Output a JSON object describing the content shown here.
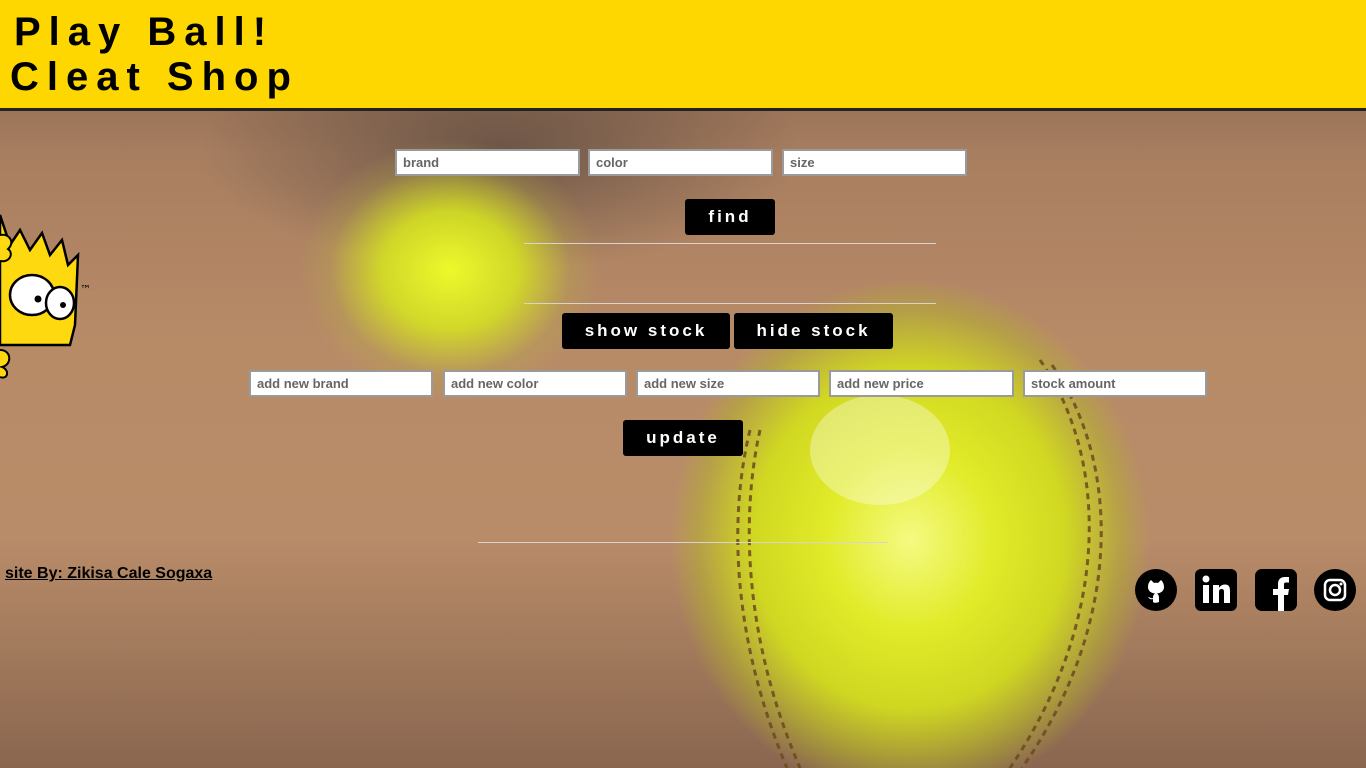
{
  "header": {
    "title_line1": "Play Ball!",
    "title_line2": "Cleat Shop"
  },
  "search": {
    "brand_placeholder": "brand",
    "color_placeholder": "color",
    "size_placeholder": "size",
    "find_label": "find"
  },
  "stock": {
    "show_label": "show stock",
    "hide_label": "hide stock"
  },
  "update_form": {
    "brand_placeholder": "add new brand",
    "color_placeholder": "add new color",
    "size_placeholder": "add new size",
    "price_placeholder": "add new price",
    "stock_placeholder": "stock amount",
    "update_label": "update"
  },
  "mascot": {
    "trademark": "™"
  },
  "footer": {
    "credit": "site By: Zikisa Cale Sogaxa",
    "social": [
      "github-icon",
      "linkedin-icon",
      "facebook-icon",
      "instagram-icon"
    ]
  },
  "colors": {
    "header_bg": "#ffd700",
    "button_bg": "#000000",
    "button_text": "#ffffff"
  }
}
